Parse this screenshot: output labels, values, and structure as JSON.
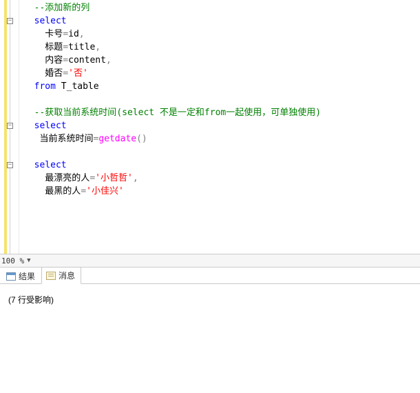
{
  "code": {
    "lines": [
      [
        {
          "t": "  ",
          "c": ""
        },
        {
          "t": "--添加新的列",
          "c": "c-comment"
        }
      ],
      [
        {
          "t": "  ",
          "c": ""
        },
        {
          "t": "select",
          "c": "c-keyword"
        }
      ],
      [
        {
          "t": "    卡号",
          "c": ""
        },
        {
          "t": "=",
          "c": "c-op"
        },
        {
          "t": "id",
          "c": ""
        },
        {
          "t": ",",
          "c": "c-op"
        }
      ],
      [
        {
          "t": "    标题",
          "c": ""
        },
        {
          "t": "=",
          "c": "c-op"
        },
        {
          "t": "title",
          "c": ""
        },
        {
          "t": ",",
          "c": "c-op"
        }
      ],
      [
        {
          "t": "    内容",
          "c": ""
        },
        {
          "t": "=",
          "c": "c-op"
        },
        {
          "t": "content",
          "c": ""
        },
        {
          "t": ",",
          "c": "c-op"
        }
      ],
      [
        {
          "t": "    婚否",
          "c": ""
        },
        {
          "t": "=",
          "c": "c-op"
        },
        {
          "t": "'",
          "c": "c-string"
        },
        {
          "t": "否",
          "c": "c-string"
        },
        {
          "t": "'",
          "c": "c-string"
        }
      ],
      [
        {
          "t": "  ",
          "c": ""
        },
        {
          "t": "from",
          "c": "c-keyword"
        },
        {
          "t": " T_table",
          "c": ""
        }
      ],
      [
        {
          "t": " ",
          "c": ""
        }
      ],
      [
        {
          "t": "  ",
          "c": ""
        },
        {
          "t": "--获取当前系统时间(select 不是一定和from一起使用，可单独使用)",
          "c": "c-comment"
        }
      ],
      [
        {
          "t": "  ",
          "c": ""
        },
        {
          "t": "select",
          "c": "c-keyword"
        }
      ],
      [
        {
          "t": "   当前系统时间",
          "c": ""
        },
        {
          "t": "=",
          "c": "c-op"
        },
        {
          "t": "getdate",
          "c": "c-func"
        },
        {
          "t": "()",
          "c": "c-op"
        }
      ],
      [
        {
          "t": " ",
          "c": ""
        }
      ],
      [
        {
          "t": "  ",
          "c": ""
        },
        {
          "t": "select",
          "c": "c-keyword"
        }
      ],
      [
        {
          "t": "    最漂亮的人",
          "c": ""
        },
        {
          "t": "=",
          "c": "c-op"
        },
        {
          "t": "'",
          "c": "c-string"
        },
        {
          "t": "小哲哲",
          "c": "c-string"
        },
        {
          "t": "'",
          "c": "c-string"
        },
        {
          "t": ",",
          "c": "c-op"
        }
      ],
      [
        {
          "t": "    最黑的人",
          "c": ""
        },
        {
          "t": "=",
          "c": "c-op"
        },
        {
          "t": "'",
          "c": "c-string"
        },
        {
          "t": "小佳兴",
          "c": "c-string"
        },
        {
          "t": "'",
          "c": "c-string"
        }
      ]
    ],
    "folds": [
      {
        "line": 1,
        "glyph": "−"
      },
      {
        "line": 9,
        "glyph": "−"
      },
      {
        "line": 12,
        "glyph": "−"
      }
    ]
  },
  "zoom": {
    "value": "100 %"
  },
  "tabs": [
    {
      "label": "结果",
      "icon": "ico-grid",
      "active": false
    },
    {
      "label": "消息",
      "icon": "ico-msg",
      "active": true
    }
  ],
  "messages": {
    "text": "(7 行受影响)"
  }
}
